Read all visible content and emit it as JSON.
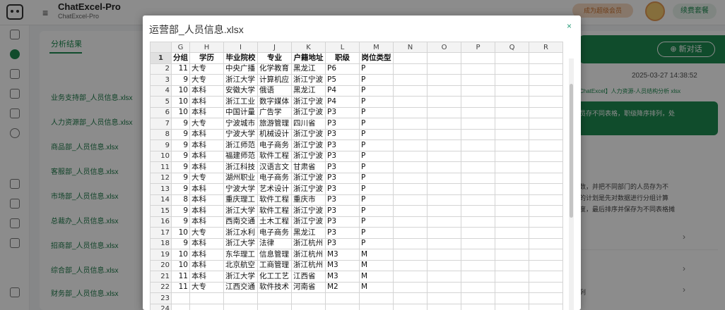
{
  "app": {
    "title": "ChatExcel-Pro",
    "subtitle": "ChatExcel-Pro",
    "vip_label": "成为超级会员",
    "renew_label": "续费套餐"
  },
  "result_panel": {
    "tab_label": "分析结果",
    "files": [
      "业务支持部_人员信息.xlsx",
      "人力资源部_人员信息.xlsx",
      "商品部_人员信息.xlsx",
      "客服部_人员信息.xlsx",
      "市场部_人员信息.xlsx",
      "总裁办_人员信息.xlsx",
      "招商部_人员信息.xlsx",
      "综合部_人员信息.xlsx",
      "财务部_人员信息.xlsx"
    ]
  },
  "chat_panel": {
    "new_chat_label": "新对话",
    "timestamp": "2025-03-27 14:38:52",
    "chip_text": "ChatExcel】人力资源-人员结构分析 xlsx",
    "bubble_text": "员存不同表格，职级降序排列，处",
    "lines": [
      "数，并把不同部门的人员存为不",
      "的计划是先对数据进行分组计算",
      "度，最后排序并保存为不同表格摊"
    ],
    "bottom_text": "列"
  },
  "modal": {
    "title": "运营部_人员信息.xlsx",
    "close_label": "×",
    "columns": [
      "G",
      "H",
      "I",
      "J",
      "K",
      "L",
      "M",
      "N",
      "O",
      "P",
      "Q",
      "R"
    ],
    "rows": [
      {
        "n": "1",
        "cells": [
          "分组",
          "学历",
          "毕业院校",
          "专业",
          "户籍地址",
          "职级",
          "岗位类型"
        ]
      },
      {
        "n": "2",
        "cells": [
          "11",
          "大专",
          "中央广播",
          "化学教育",
          "黑龙江",
          "P6",
          "P"
        ]
      },
      {
        "n": "3",
        "cells": [
          "9",
          "大专",
          "浙江大学",
          "计算机应",
          "浙江宁波",
          "P5",
          "P"
        ]
      },
      {
        "n": "4",
        "cells": [
          "10",
          "本科",
          "安徽大学",
          "俄语",
          "黑龙江",
          "P4",
          "P"
        ]
      },
      {
        "n": "5",
        "cells": [
          "10",
          "本科",
          "浙江工业",
          "数字媒体",
          "浙江宁波",
          "P4",
          "P"
        ]
      },
      {
        "n": "6",
        "cells": [
          "10",
          "本科",
          "中国计量",
          "广告学",
          "浙江宁波",
          "P3",
          "P"
        ]
      },
      {
        "n": "7",
        "cells": [
          "9",
          "大专",
          "宁波城市",
          "旅游管理",
          "四川省",
          "P3",
          "P"
        ]
      },
      {
        "n": "8",
        "cells": [
          "9",
          "本科",
          "宁波大学",
          "机械设计",
          "浙江宁波",
          "P3",
          "P"
        ]
      },
      {
        "n": "9",
        "cells": [
          "9",
          "本科",
          "浙江师范",
          "电子商务",
          "浙江宁波",
          "P3",
          "P"
        ]
      },
      {
        "n": "10",
        "cells": [
          "9",
          "本科",
          "福建师范",
          "软件工程",
          "浙江宁波",
          "P3",
          "P"
        ]
      },
      {
        "n": "11",
        "cells": [
          "9",
          "本科",
          "浙江科技",
          "汉语言文",
          "甘肃省",
          "P3",
          "P"
        ]
      },
      {
        "n": "12",
        "cells": [
          "9",
          "大专",
          "湖州职业",
          "电子商务",
          "浙江宁波",
          "P3",
          "P"
        ]
      },
      {
        "n": "13",
        "cells": [
          "9",
          "本科",
          "宁波大学",
          "艺术设计",
          "浙江宁波",
          "P3",
          "P"
        ]
      },
      {
        "n": "14",
        "cells": [
          "8",
          "本科",
          "重庆理工",
          "软件工程",
          "重庆市",
          "P3",
          "P"
        ]
      },
      {
        "n": "15",
        "cells": [
          "9",
          "本科",
          "浙江大学",
          "软件工程",
          "浙江宁波",
          "P3",
          "P"
        ]
      },
      {
        "n": "16",
        "cells": [
          "9",
          "本科",
          "西南交通",
          "土木工程",
          "浙江宁波",
          "P3",
          "P"
        ]
      },
      {
        "n": "17",
        "cells": [
          "10",
          "大专",
          "浙江水利",
          "电子商务",
          "黑龙江",
          "P3",
          "P"
        ]
      },
      {
        "n": "18",
        "cells": [
          "9",
          "本科",
          "浙江大学",
          "法律",
          "浙江杭州",
          "P3",
          "P"
        ]
      },
      {
        "n": "19",
        "cells": [
          "10",
          "本科",
          "东华理工",
          "信息管理",
          "浙江杭州",
          "M3",
          "M"
        ]
      },
      {
        "n": "20",
        "cells": [
          "10",
          "本科",
          "北京航空",
          "工商管理",
          "浙江杭州",
          "M3",
          "M"
        ]
      },
      {
        "n": "21",
        "cells": [
          "11",
          "本科",
          "浙江大学",
          "化工工艺",
          "江西省",
          "M3",
          "M"
        ]
      },
      {
        "n": "22",
        "cells": [
          "11",
          "大专",
          "江西交通",
          "软件技术",
          "河南省",
          "M2",
          "M"
        ]
      },
      {
        "n": "23",
        "cells": [
          "",
          "",
          "",
          "",
          "",
          "",
          ""
        ]
      },
      {
        "n": "24",
        "cells": [
          "",
          "",
          "",
          "",
          "",
          "",
          ""
        ]
      }
    ]
  },
  "colors": {
    "accent": "#1e8a50",
    "close": "#2a9d7a"
  }
}
